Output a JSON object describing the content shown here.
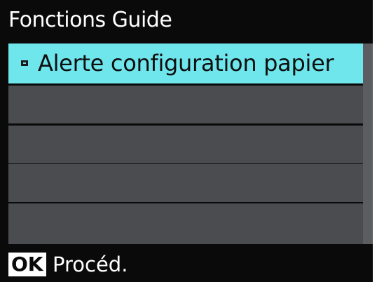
{
  "header": {
    "title": "Fonctions Guide"
  },
  "menu": {
    "items": [
      {
        "label": "Alerte configuration papier",
        "selected": true
      },
      {
        "label": "",
        "selected": false
      },
      {
        "label": "",
        "selected": false
      },
      {
        "label": "",
        "selected": false
      },
      {
        "label": "",
        "selected": false
      }
    ]
  },
  "footer": {
    "ok_key": "OK",
    "action_label": "Procéd."
  },
  "colors": {
    "background": "#0a0a0a",
    "selected_row": "#6fe5ec",
    "row": "#4a4c50",
    "scrollbar": "#5b5d60"
  }
}
